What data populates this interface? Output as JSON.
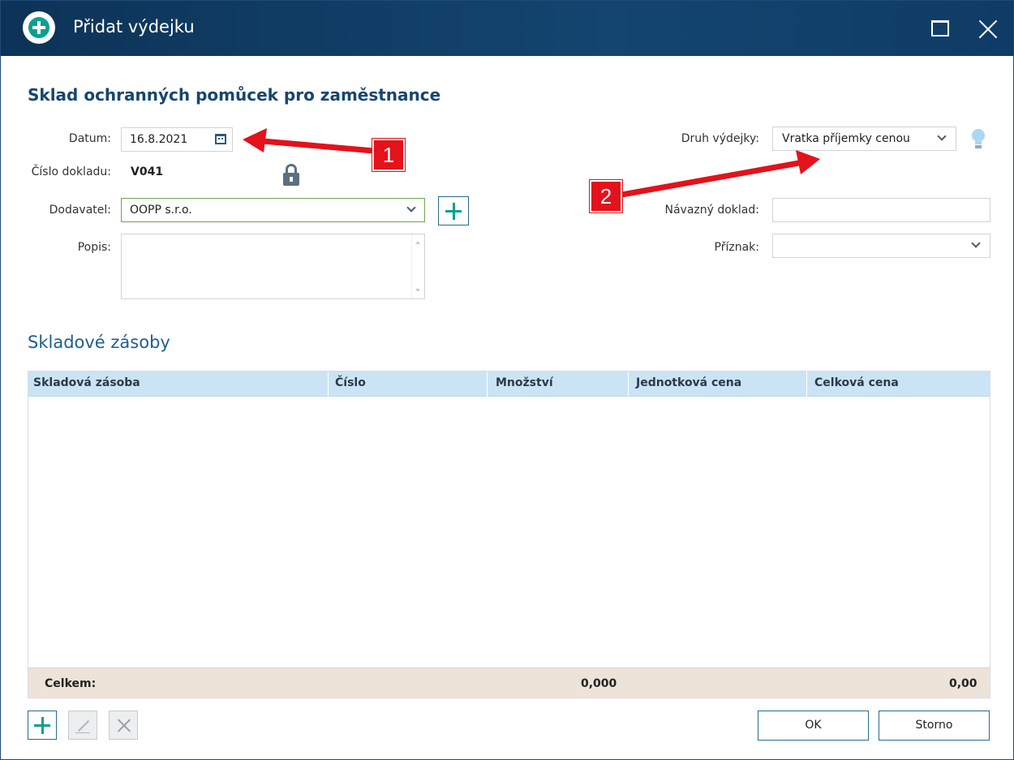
{
  "window": {
    "title": "Přidat výdejku",
    "controls": {
      "maximize_icon": "maximize-icon",
      "close_icon": "close-icon"
    }
  },
  "form": {
    "heading": "Sklad ochranných pomůcek pro zaměstnance",
    "date": {
      "label": "Datum:",
      "value": "16.8.2021",
      "icon": "calendar-icon"
    },
    "doc_number": {
      "label": "Číslo dokladu:",
      "value": "V041",
      "icon": "lock-icon"
    },
    "supplier": {
      "label": "Dodavatel:",
      "value": "OOPP s.r.o.",
      "add_icon": "plus-icon"
    },
    "description": {
      "label": "Popis:",
      "value": ""
    },
    "issue_type": {
      "label": "Druh výdejky:",
      "value": "Vratka příjemky cenou",
      "hint_icon": "lightbulb-icon"
    },
    "related_doc": {
      "label": "Návazný doklad:",
      "value": ""
    },
    "flag": {
      "label": "Příznak:",
      "value": ""
    }
  },
  "stock": {
    "section_title": "Skladové zásoby",
    "columns": [
      "Skladová zásoba",
      "Číslo",
      "Množství",
      "Jednotková cena",
      "Celková cena"
    ],
    "rows": [],
    "footer": {
      "label": "Celkem:",
      "quantity_total": "0,000",
      "price_total": "0,00"
    }
  },
  "toolbar": {
    "add_icon": "plus-icon",
    "edit_icon": "edit-icon",
    "delete_icon": "delete-icon"
  },
  "actions": {
    "ok": "OK",
    "cancel": "Storno"
  },
  "annotations": {
    "callout_1": "1",
    "callout_2": "2",
    "color": "#e3121b"
  },
  "colors": {
    "title_bar": "#0f3c66",
    "accent": "#0aa08f",
    "table_header": "#cbe4f5",
    "table_footer": "#ede3d8"
  }
}
